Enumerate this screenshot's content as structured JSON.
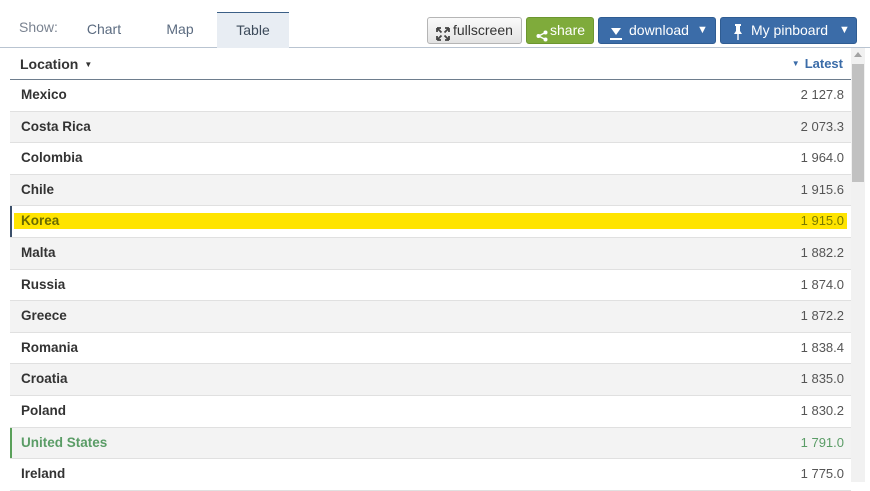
{
  "toolbar": {
    "show_label": "Show:",
    "tabs": [
      {
        "label": "Chart"
      },
      {
        "label": "Map"
      },
      {
        "label": "Table",
        "active": true
      }
    ],
    "fullscreen_label": "fullscreen",
    "share_label": "share",
    "download_label": "download",
    "pinboard_label": "My pinboard"
  },
  "table": {
    "headers": {
      "location": "Location",
      "latest": "Latest"
    },
    "rows": [
      {
        "location": "Mexico",
        "value": "2 127.8"
      },
      {
        "location": "Costa Rica",
        "value": "2 073.3"
      },
      {
        "location": "Colombia",
        "value": "1 964.0"
      },
      {
        "location": "Chile",
        "value": "1 915.6"
      },
      {
        "location": "Korea",
        "value": "1 915.0"
      },
      {
        "location": "Malta",
        "value": "1 882.2"
      },
      {
        "location": "Russia",
        "value": "1 874.0"
      },
      {
        "location": "Greece",
        "value": "1 872.2"
      },
      {
        "location": "Romania",
        "value": "1 838.4"
      },
      {
        "location": "Croatia",
        "value": "1 835.0"
      },
      {
        "location": "Poland",
        "value": "1 830.2"
      },
      {
        "location": "United States",
        "value": "1 791.0"
      },
      {
        "location": "Ireland",
        "value": "1 775.0"
      }
    ]
  },
  "colors": {
    "accent": "#3b6ca8",
    "share": "#7fab3b",
    "highlight_korea": "#ffe400",
    "highlight_us": "#5a9c66"
  }
}
